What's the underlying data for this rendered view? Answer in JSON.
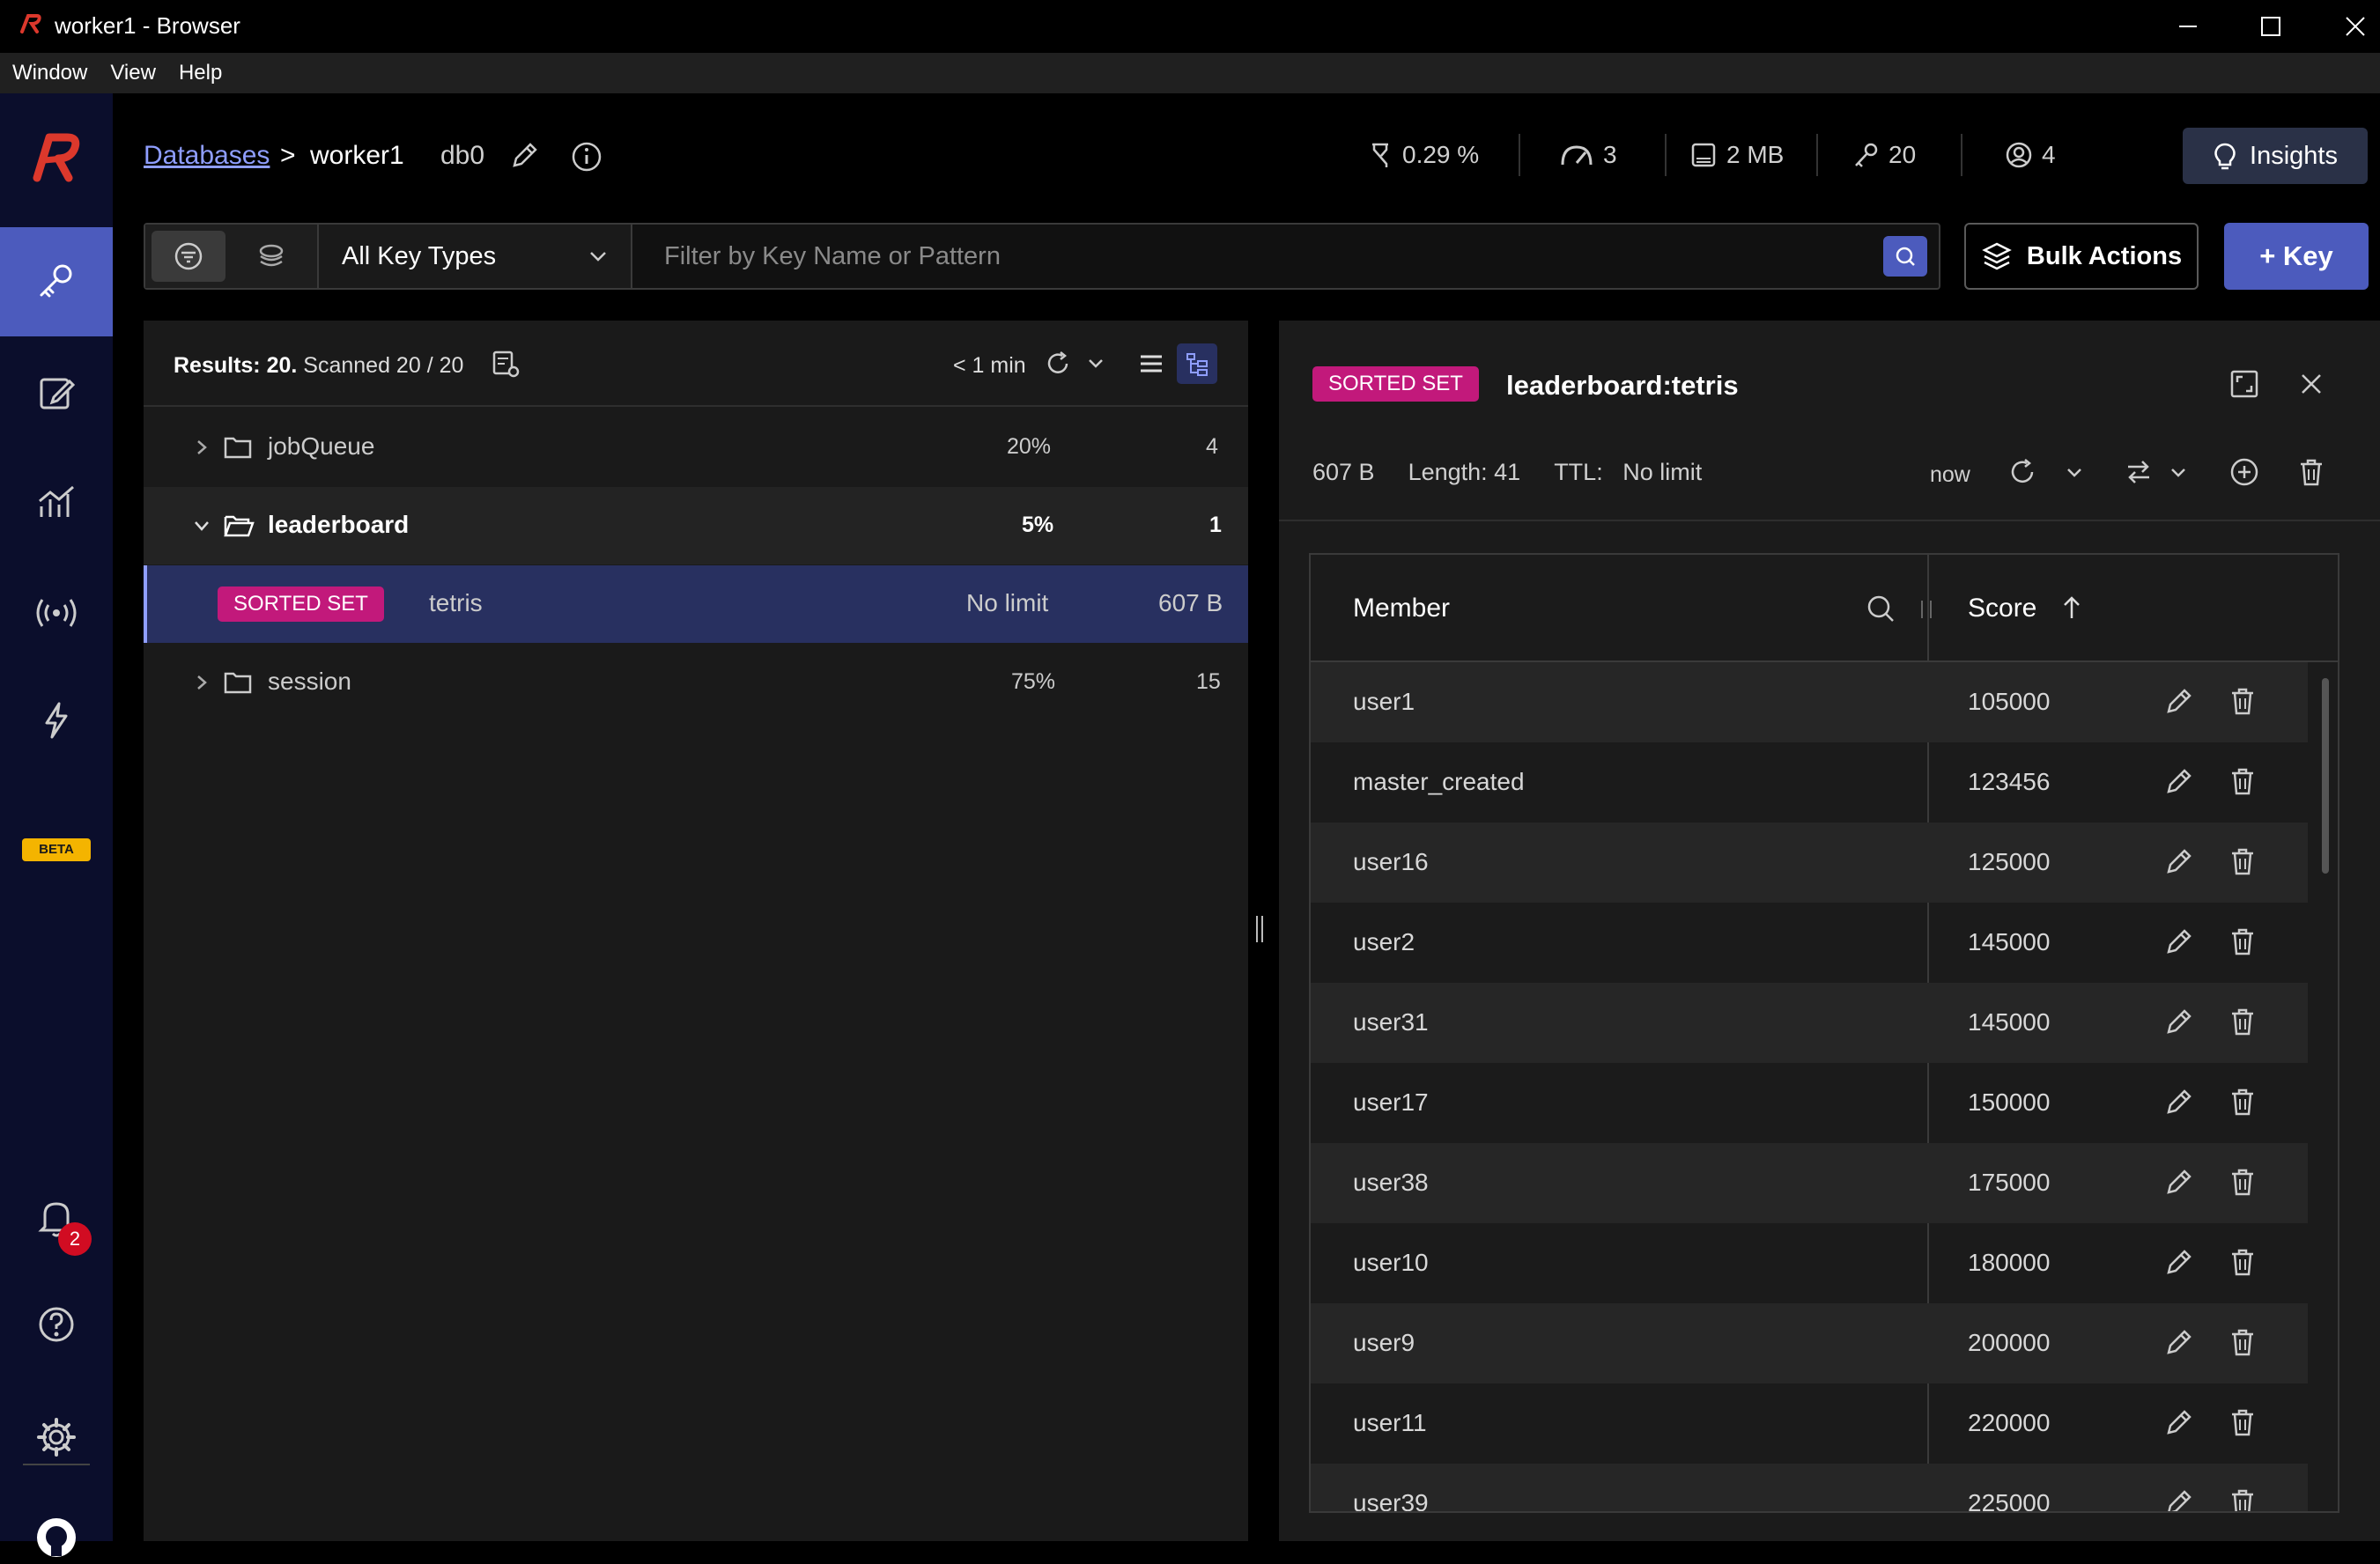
{
  "window": {
    "title": "worker1 - Browser"
  },
  "menu": [
    "Window",
    "View",
    "Help"
  ],
  "sidebar": {
    "beta_label": "BETA",
    "notifications_count": "2"
  },
  "header": {
    "breadcrumb_root": "Databases",
    "breadcrumb_sep": ">",
    "db_name": "worker1",
    "db_index": "db0",
    "stats": {
      "cpu": "0.29 %",
      "ops": "3",
      "memory": "2 MB",
      "keys": "20",
      "clients": "4"
    },
    "insights_label": "Insights"
  },
  "filter": {
    "key_type": "All Key Types",
    "search_placeholder": "Filter by Key Name or Pattern",
    "bulk_actions_label": "Bulk Actions",
    "add_key_label": "+ Key"
  },
  "keylist": {
    "results_label": "Results: 20.",
    "scanned_label": "Scanned 20 / 20",
    "refresh_age": "< 1 min",
    "rows": [
      {
        "name": "jobQueue",
        "percent": "20%",
        "count": "4"
      },
      {
        "name": "leaderboard",
        "percent": "5%",
        "count": "1"
      },
      {
        "type": "SORTED SET",
        "name": "tetris",
        "ttl": "No limit",
        "size": "607 B"
      },
      {
        "name": "session",
        "percent": "75%",
        "count": "15"
      }
    ]
  },
  "detail": {
    "type": "SORTED SET",
    "key_name": "leaderboard:tetris",
    "size": "607 B",
    "length": "Length: 41",
    "ttl_label": "TTL:",
    "ttl_value": "No limit",
    "updated": "now",
    "columns": {
      "member": "Member",
      "score": "Score"
    },
    "rows": [
      {
        "member": "user1",
        "score": "105000"
      },
      {
        "member": "master_created",
        "score": "123456"
      },
      {
        "member": "user16",
        "score": "125000"
      },
      {
        "member": "user2",
        "score": "145000"
      },
      {
        "member": "user31",
        "score": "145000"
      },
      {
        "member": "user17",
        "score": "150000"
      },
      {
        "member": "user38",
        "score": "175000"
      },
      {
        "member": "user10",
        "score": "180000"
      },
      {
        "member": "user9",
        "score": "200000"
      },
      {
        "member": "user11",
        "score": "220000"
      },
      {
        "member": "user39",
        "score": "225000"
      }
    ]
  },
  "colors": {
    "accent": "#4c5bbd",
    "badge": "#c2197b",
    "sidebar": "#0b0e2c",
    "logo": "#dc382c"
  }
}
